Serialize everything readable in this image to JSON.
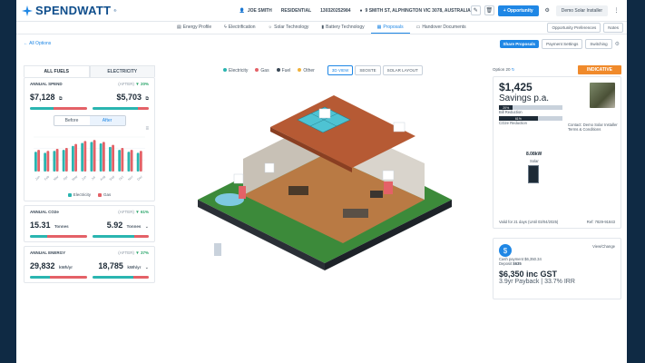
{
  "brand": {
    "name": "SPENDWATT",
    "trademark": "®"
  },
  "header": {
    "customer": "JOE SMITH",
    "type": "RESIDENTIAL",
    "phone": "130320252984",
    "address": "9 SMITH ST, ALPHINGTON VIC 3078, AUSTRALIA",
    "opportunity_label": "+ Opportunity",
    "installer": "Demo Solar Installer"
  },
  "tabs": [
    {
      "label": "Energy Profile",
      "icon": "chart-icon"
    },
    {
      "label": "Electrification",
      "icon": "bolt-icon"
    },
    {
      "label": "Solar Technology",
      "icon": "sun-icon"
    },
    {
      "label": "Battery Technology",
      "icon": "battery-icon"
    },
    {
      "label": "Proposals",
      "icon": "document-icon",
      "active": true
    },
    {
      "label": "Handover Documents",
      "icon": "folder-icon"
    }
  ],
  "tab_actions": {
    "preferences": "Opportunity Preferences",
    "notes": "Notes"
  },
  "toolbar": {
    "back": "← All Options",
    "share": "Share Proposals",
    "payment": "Payment Settings",
    "switching": "Switching"
  },
  "fuel_tabs": [
    "ALL FUELS",
    "ELECTRICITY"
  ],
  "spend": {
    "title": "ANNUAL SPEND",
    "after_label": "(AFTER)",
    "pct": "▼ 20%",
    "before": "$7,128",
    "after": "$5,703",
    "before_fill": 0.55,
    "after_fill": 0.42
  },
  "toggle": {
    "before": "Before",
    "after": "After"
  },
  "chart_data": {
    "type": "bar",
    "categories": [
      "Jan",
      "Feb",
      "Mar",
      "Apr",
      "May",
      "Jun",
      "Jul",
      "Aug",
      "Sep",
      "Oct",
      "Nov",
      "Dec"
    ],
    "series": [
      {
        "name": "Electricity",
        "color": "#2ab5b0",
        "values": [
          40,
          38,
          42,
          44,
          52,
          58,
          60,
          57,
          50,
          44,
          40,
          38
        ]
      },
      {
        "name": "Gas",
        "color": "#e46167",
        "values": [
          44,
          42,
          46,
          48,
          56,
          62,
          64,
          60,
          54,
          48,
          44,
          42
        ]
      }
    ]
  },
  "co2": {
    "title": "ANNUAL CO2e",
    "after_label": "(AFTER)",
    "pct": "▼ 61%",
    "before": "15.31",
    "after": "5.92",
    "unit": "Tonnes"
  },
  "energy": {
    "title": "ANNUAL ENERGY",
    "after_label": "(AFTER)",
    "pct": "▼ 37%",
    "before": "29,832",
    "after": "18,785",
    "unit": "kWh/yr"
  },
  "legend_center": [
    {
      "label": "Electricity",
      "color": "#2ab5b0"
    },
    {
      "label": "Gas",
      "color": "#e46167"
    },
    {
      "label": "Fuel",
      "color": "#3a4856"
    },
    {
      "label": "Other",
      "color": "#f0b13a"
    }
  ],
  "views": [
    "3D VIEW",
    "SEOSTE",
    "SOLAR LAYOUT"
  ],
  "option": {
    "label": "Option 20",
    "badge": "INDICATIVE",
    "savings": "$1,425",
    "savings_sub": "Savings p.a.",
    "bill_pct": "20%",
    "bill_label": "Bill Reduction",
    "co2_pct": "61%",
    "co2_label": "CO2e Reduction",
    "contact": "Contact: Demo Solar Installer",
    "terms": "Terms & Conditions",
    "solar_kw": "8.08kW",
    "solar_label": "Solar",
    "valid": "Valid for 21 days (Until 03/04/2025)",
    "ref": "Ref: 7829-91843"
  },
  "payment": {
    "view_change": "View/Change",
    "cash": "Cash payment $6,350.34",
    "deposit_label": "Deposit",
    "deposit": "$635",
    "price": "$6,350 inc GST",
    "payback": "3.9yr Payback | 33.7% IRR"
  }
}
